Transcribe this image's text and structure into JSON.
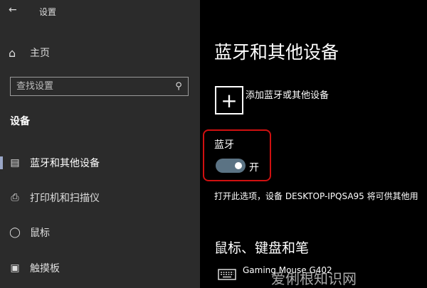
{
  "window": {
    "title": "设置",
    "back_icon": "arrow-left-icon"
  },
  "sidebar": {
    "home_label": "主页",
    "search_placeholder": "查找设置",
    "section_title": "设备",
    "items": [
      {
        "label": "蓝牙和其他设备",
        "icon": "bluetooth-devices-icon",
        "active": true
      },
      {
        "label": "打印机和扫描仪",
        "icon": "printer-icon",
        "active": false
      },
      {
        "label": "鼠标",
        "icon": "mouse-icon",
        "active": false
      },
      {
        "label": "触摸板",
        "icon": "touchpad-icon",
        "active": false
      }
    ]
  },
  "main": {
    "page_title": "蓝牙和其他设备",
    "add_device_label": "添加蓝牙或其他设备",
    "bluetooth_label": "蓝牙",
    "bluetooth_state": "开",
    "bluetooth_on": true,
    "description": "打开此选项，设备 DESKTOP-IPQSA95 将可供其他用",
    "section_mouse_keyboard": "鼠标、键盘和笔",
    "device_name": "Gaming Mouse G402"
  },
  "watermark": "爱俐根知识网",
  "colors": {
    "sidebar_bg": "#2b2b2b",
    "main_bg": "#000000",
    "toggle_on": "#5b7384",
    "highlight": "#d01010",
    "active_indicator": "#9aa7c8"
  }
}
